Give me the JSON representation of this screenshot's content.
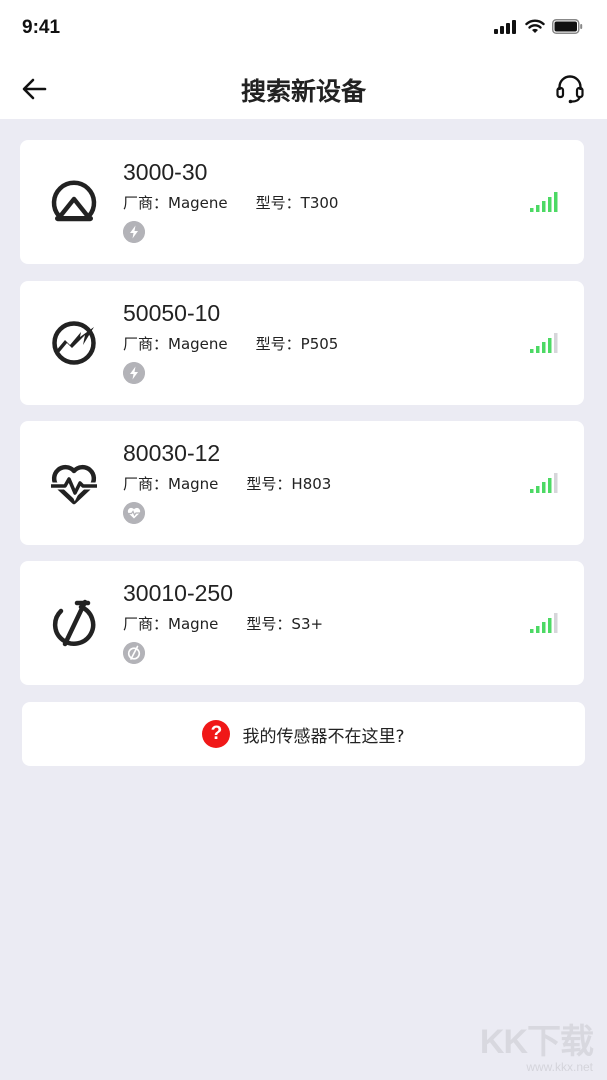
{
  "status_bar": {
    "time": "9:41"
  },
  "header": {
    "title": "搜索新设备"
  },
  "devices": [
    {
      "name": "3000-30",
      "maker_label": "厂商：",
      "maker": "Magene",
      "model_label": "型号：",
      "model": "T300",
      "type_icon": "lightning-icon",
      "device_icon": "trainer-icon",
      "signal_bars": 5
    },
    {
      "name": "50050-10",
      "maker_label": "厂商：",
      "maker": "Magene",
      "model_label": "型号：",
      "model": "P505",
      "type_icon": "lightning-icon",
      "device_icon": "power-meter-icon",
      "signal_bars": 4
    },
    {
      "name": "80030-12",
      "maker_label": "厂商：",
      "maker": "Magne",
      "model_label": "型号：",
      "model": "H803",
      "type_icon": "heart-icon",
      "device_icon": "heart-rate-icon",
      "signal_bars": 4
    },
    {
      "name": "30010-250",
      "maker_label": "厂商：",
      "maker": "Magne",
      "model_label": "型号：",
      "model": "S3+",
      "type_icon": "speed-icon",
      "device_icon": "speed-sensor-icon",
      "signal_bars": 4
    }
  ],
  "help": {
    "icon_text": "?",
    "text": "我的传感器不在这里?"
  },
  "watermark": {
    "main": "KK下载",
    "sub": "www.kkx.net"
  },
  "colors": {
    "signal_active": "#4cd964",
    "signal_inactive": "#d6d6da",
    "help_icon": "#f01818",
    "background": "#ebebf3",
    "badge": "#b3b3b8"
  }
}
